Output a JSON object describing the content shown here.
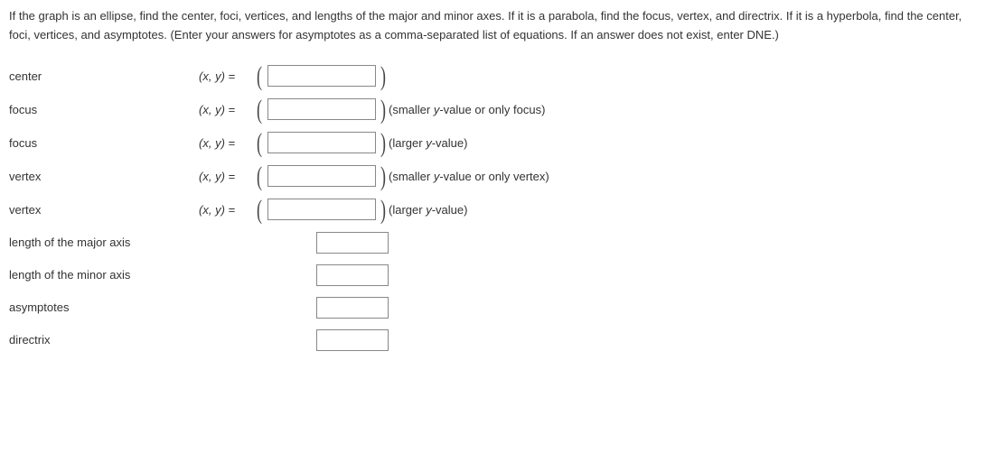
{
  "instructions": "If the graph is an ellipse, find the center, foci, vertices, and lengths of the major and minor axes. If it is a parabola, find the focus, vertex, and directrix. If it is a hyperbola, find the center, foci, vertices, and asymptotes. (Enter your answers for asymptotes as a comma-separated list of equations. If an answer does not exist, enter DNE.)",
  "rows": {
    "center": {
      "label": "center",
      "eq_prefix_html": "(<span class='italic-var'>x</span>, <span class='italic-var'>y</span>) = ",
      "hint": ""
    },
    "focus1": {
      "label": "focus",
      "hint_pre": "(smaller ",
      "hint_var": "y",
      "hint_post": "-value or only focus)"
    },
    "focus2": {
      "label": "focus",
      "hint_pre": "(larger ",
      "hint_var": "y",
      "hint_post": "-value)"
    },
    "vertex1": {
      "label": "vertex",
      "hint_pre": "(smaller ",
      "hint_var": "y",
      "hint_post": "-value or only vertex)"
    },
    "vertex2": {
      "label": "vertex",
      "hint_pre": "(larger ",
      "hint_var": "y",
      "hint_post": "-value)"
    },
    "major": {
      "label": "length of the major axis"
    },
    "minor": {
      "label": "length of the minor axis"
    },
    "asymptotes": {
      "label": "asymptotes"
    },
    "directrix": {
      "label": "directrix"
    }
  },
  "eq": {
    "x": "x",
    "y": "y",
    "sep": ", ",
    "equals": ") = "
  }
}
